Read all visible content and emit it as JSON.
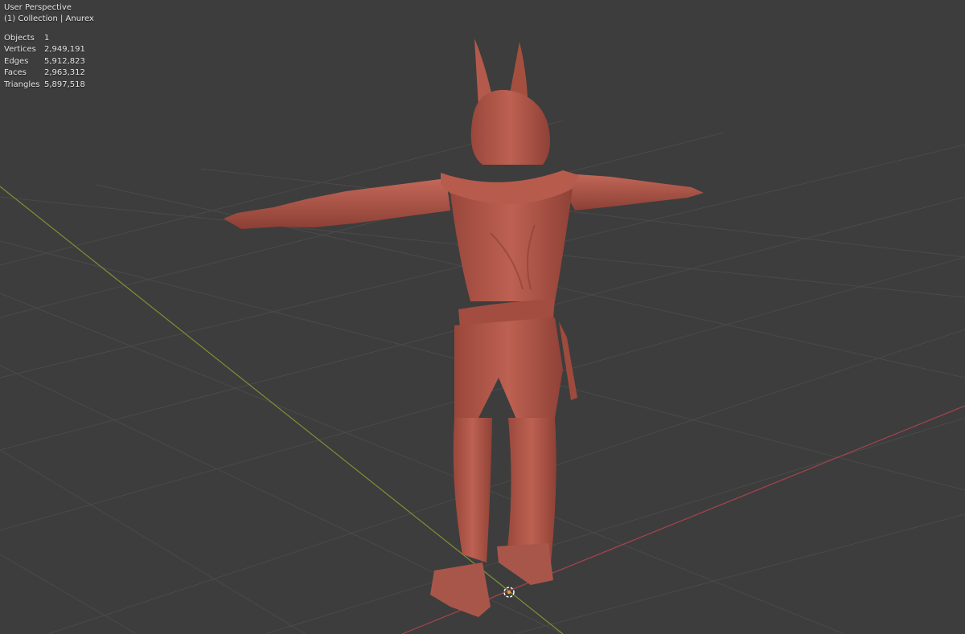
{
  "viewport": {
    "view_name": "User Perspective",
    "collection_label": "(1) Collection | Anurex",
    "object_name": "Anurex",
    "model_color": "#b45a4c",
    "background_color": "#3d3d3d",
    "grid_color": "#4a4a4a",
    "x_axis_color": "#a8434e",
    "y_axis_color": "#7d9233"
  },
  "stats": [
    {
      "label": "Objects",
      "value": "1"
    },
    {
      "label": "Vertices",
      "value": "2,949,191"
    },
    {
      "label": "Edges",
      "value": "5,912,823"
    },
    {
      "label": "Faces",
      "value": "2,963,312"
    },
    {
      "label": "Triangles",
      "value": "5,897,518"
    }
  ],
  "icons": {
    "origin": "3d-cursor-icon"
  }
}
